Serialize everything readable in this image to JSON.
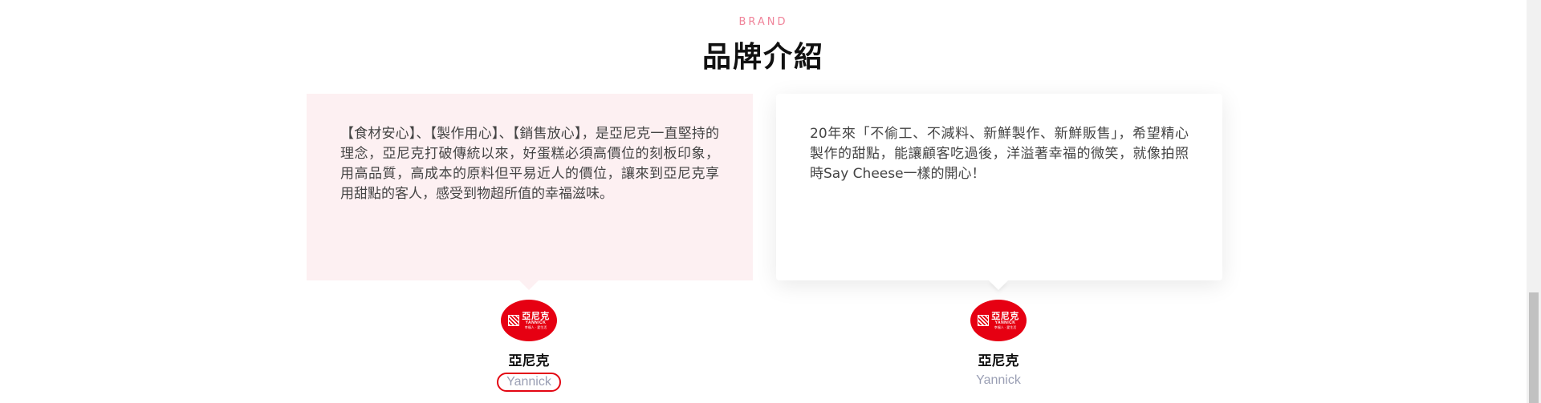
{
  "section": {
    "eyebrow": "BRAND",
    "title": "品牌介紹"
  },
  "cards": [
    {
      "text": "【食材安心】、【製作用心】、【銷售放心】，是亞尼克一直堅持的理念，亞尼克打破傳統以來，好蛋糕必須高價位的刻板印象，用高品質，高成本的原料但平易近人的價位，讓來到亞尼克享用甜點的客人，感受到物超所值的幸福滋味。",
      "background": "#fdf0f2"
    },
    {
      "text": "20年來「不偷工、不減料、新鮮製作、新鮮販售」，希望精心製作的甜點，能讓顧客吃過後，洋溢著幸福的微笑，就像拍照時Say Cheese一樣的開心！",
      "background": "#ffffff"
    }
  ],
  "authors": [
    {
      "logo_name": "亞尼克",
      "logo_en": "YANNICK",
      "logo_slogan": "幸福人 · 愛生活",
      "name": "亞尼克",
      "subtitle": "Yannick",
      "highlighted": true
    },
    {
      "logo_name": "亞尼克",
      "logo_en": "YANNICK",
      "logo_slogan": "幸福人 · 愛生活",
      "name": "亞尼克",
      "subtitle": "Yannick",
      "highlighted": false
    }
  ],
  "colors": {
    "accent": "#f0849a",
    "brand_red": "#e60012",
    "highlight_ring": "#e30613"
  },
  "icons": {
    "logo": "yannick-logo-icon"
  }
}
